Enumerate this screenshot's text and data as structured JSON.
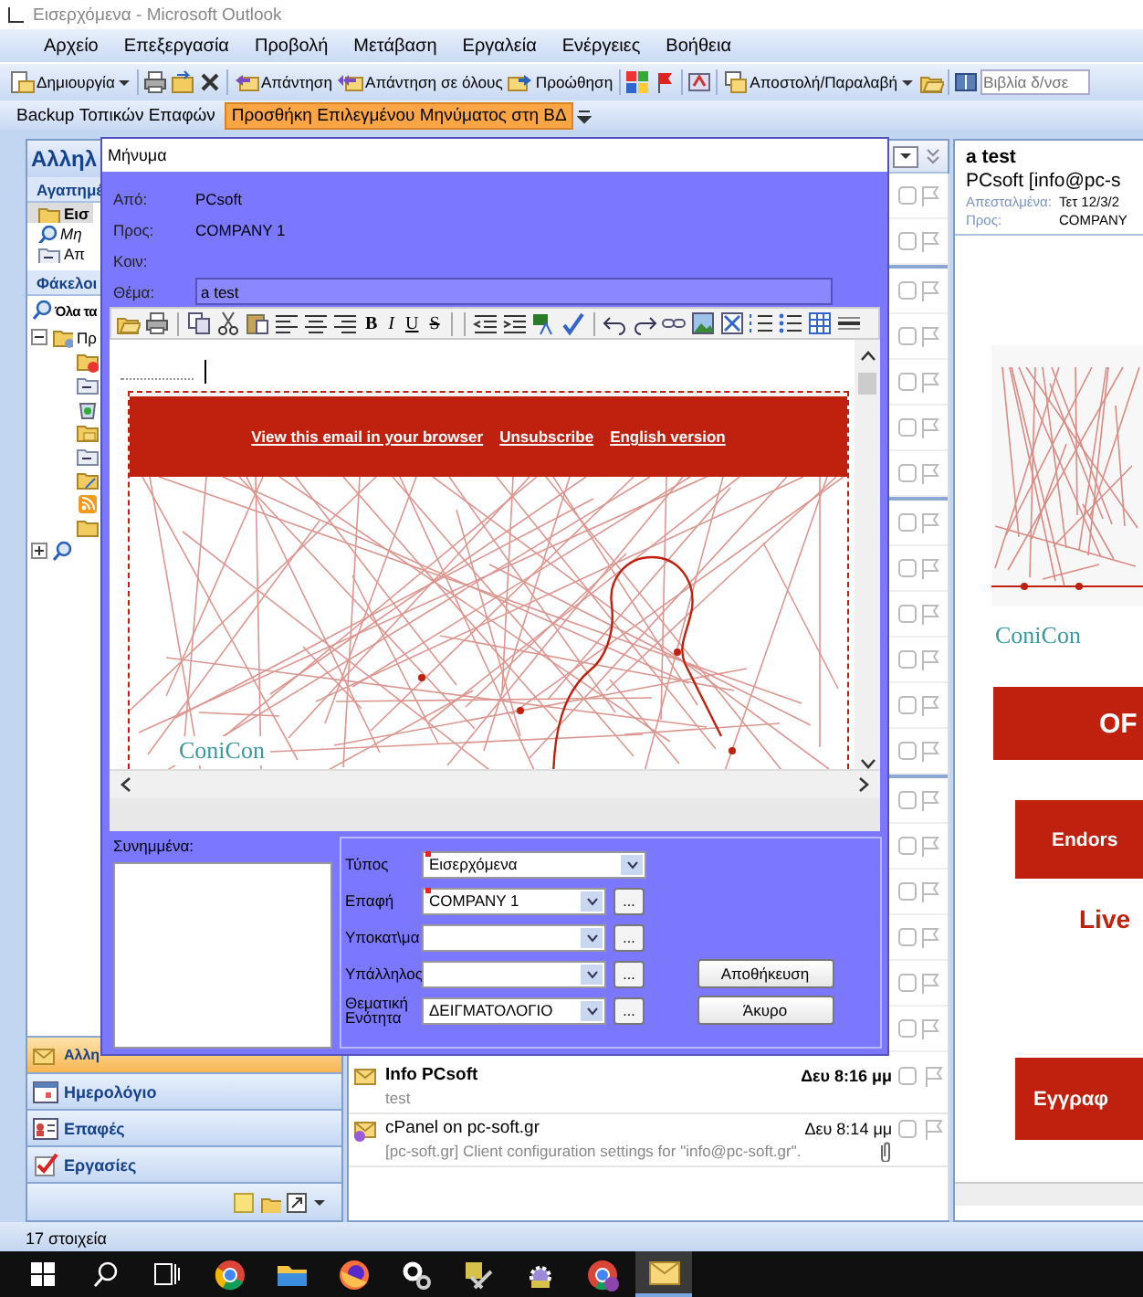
{
  "window": {
    "title": "Εισερχόμενα - Microsoft Outlook"
  },
  "menu": [
    "Αρχείο",
    "Επεξεργασία",
    "Προβολή",
    "Μετάβαση",
    "Εργαλεία",
    "Ενέργειες",
    "Βοήθεια"
  ],
  "toolbar": {
    "new": "Δημιουργία",
    "reply": "Απάντηση",
    "reply_all": "Απάντηση σε όλους",
    "forward": "Προώθηση",
    "send_receive": "Αποστολή/Παραλαβή",
    "search_placeholder": "Βιβλία δ/νσε"
  },
  "custom_toolbar": [
    {
      "label": "Backup Τοπικών Επαφών",
      "selected": false
    },
    {
      "label": "Προσθήκη Επιλεγμένου Μηνύματος στη ΒΔ",
      "selected": true
    }
  ],
  "navigation": {
    "header": "Αλληλ",
    "favorites_header": "Αγαπημέ",
    "favorites": [
      {
        "label": "Εισ",
        "kind": "inbox",
        "selected": true
      },
      {
        "label": "Μη",
        "kind": "search",
        "selected": false
      },
      {
        "label": "Απ",
        "kind": "sent",
        "selected": false
      }
    ],
    "folders_header": "Φάκελοι ",
    "all_items": "Όλα τα",
    "tree": [
      {
        "label": "Πρ",
        "expanded": true
      },
      {
        "expanded": false
      }
    ],
    "buttons": [
      {
        "label": "Αλλη",
        "selected": true
      },
      {
        "label": "Ημερολόγιο",
        "selected": false
      },
      {
        "label": "Επαφές",
        "selected": false
      },
      {
        "label": "Εργασίες",
        "selected": false
      }
    ]
  },
  "messages": [
    {
      "sender": "Info PCsoft",
      "preview": "test",
      "time": "Δευ 8:16 μμ",
      "unread": true,
      "attachment": false
    },
    {
      "sender": "cPanel on pc-soft.gr",
      "preview": "[pc-soft.gr] Client configuration settings for \"info@pc-soft.gr\".",
      "time": "Δευ 8:14 μμ",
      "unread": false,
      "attachment": true
    }
  ],
  "reading_pane": {
    "subject": "a test",
    "from": "PCsoft [info@pc-s",
    "sent_label": "Απεσταλμένα:",
    "sent_value": "Τετ 12/3/2",
    "to_label": "Προς:",
    "to_value": "COMPANY",
    "logo": "ConiCon",
    "blocks": [
      {
        "kind": "banner",
        "text": "OF"
      },
      {
        "kind": "banner",
        "text": "Endors"
      },
      {
        "kind": "heading",
        "text": "Live"
      },
      {
        "kind": "banner",
        "text": "Εγγραφ"
      }
    ]
  },
  "dialog": {
    "title": "Μήνυμα",
    "fields": [
      {
        "label": "Από:",
        "value": "PCsoft",
        "kind": "text"
      },
      {
        "label": "Προς:",
        "value": "COMPANY 1",
        "kind": "text"
      },
      {
        "label": "Κοιν:",
        "kind": "text"
      },
      {
        "label": "Θέμα:",
        "value": "a test",
        "kind": "input"
      }
    ],
    "format_buttons": [
      "B",
      "I",
      "U",
      "S"
    ],
    "email": {
      "links": [
        "View this email in your browser",
        "Unsubscribe",
        "English version"
      ],
      "logo": "ConiCon"
    },
    "attachments_label": "Συνημμένα:",
    "form": [
      {
        "label": "Τύπος",
        "value": "Εισερχόμενα",
        "required": true
      },
      {
        "label": "Επαφή",
        "value": "COMPANY 1",
        "required": true,
        "browse": "..."
      },
      {
        "label": "Υποκατ\\μα",
        "required": false,
        "browse": "..."
      },
      {
        "label": "Υπάλληλος",
        "required": false,
        "browse": "..."
      },
      {
        "label": "Θεματική Ενότητα",
        "value": "ΔΕΙΓΜΑΤΟΛΟΓΙΟ",
        "required": false,
        "browse": "..."
      }
    ],
    "buttons": [
      "Αποθήκευση",
      "Άκυρο"
    ]
  },
  "status_bar": "17 στοιχεία",
  "taskbar": [
    {
      "selected": false
    },
    {
      "selected": false
    },
    {
      "selected": false
    },
    {
      "selected": false
    },
    {
      "selected": false
    },
    {
      "selected": false
    },
    {
      "selected": false
    },
    {
      "selected": false
    },
    {
      "selected": false
    },
    {
      "selected": false
    },
    {
      "selected": true
    }
  ]
}
